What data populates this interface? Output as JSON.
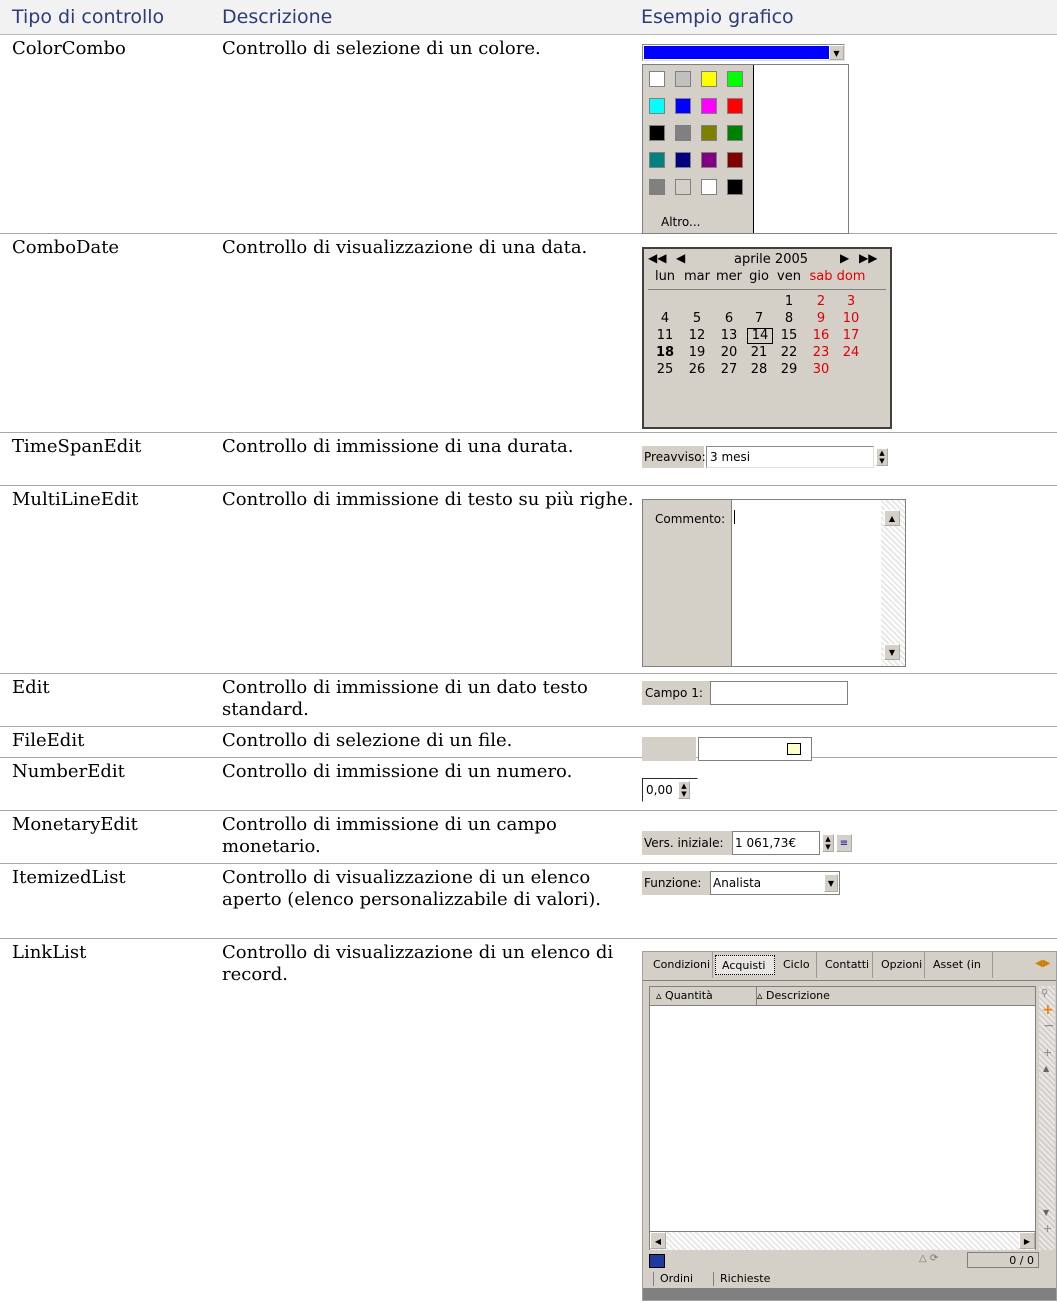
{
  "header": {
    "col_type": "Tipo di controllo",
    "col_desc": "Descrizione",
    "col_example": "Esempio grafico"
  },
  "rows": [
    {
      "type": "ColorCombo",
      "desc": "Controllo di selezione di un colore."
    },
    {
      "type": "ComboDate",
      "desc": "Controllo di visualizzazione di una data."
    },
    {
      "type": "TimeSpanEdit",
      "desc": "Controllo di immissione di una durata."
    },
    {
      "type": "MultiLineEdit",
      "desc": "Controllo di immissione di testo su più righe."
    },
    {
      "type": "Edit",
      "desc": "Controllo di immissione di un dato testo standard."
    },
    {
      "type": "FileEdit",
      "desc": "Controllo di selezione di un file."
    },
    {
      "type": "NumberEdit",
      "desc": "Controllo di immissione di un numero."
    },
    {
      "type": "MonetaryEdit",
      "desc": "Controllo di immissione di un campo monetario."
    },
    {
      "type": "ItemizedList",
      "desc": "Controllo di visualizzazione di un elenco aperto (elenco personalizzabile di valori)."
    },
    {
      "type": "LinkList",
      "desc": "Controllo di visualizzazione di un elenco di record."
    }
  ],
  "colorcombo": {
    "selected_color": "#0000ff",
    "swatches": [
      "#ffffff",
      "#c0c0c0",
      "#ffff00",
      "#00ff00",
      "#00ffff",
      "#0000ff",
      "#ff00ff",
      "#ff0000",
      "#000000",
      "#808080",
      "#808000",
      "#008000",
      "#008080",
      "#000080",
      "#800080",
      "#800000",
      "#808080",
      "#d4d0c8",
      "#ffffff",
      "#000000"
    ],
    "other_label": "Altro..."
  },
  "calendar": {
    "month": "aprile 2005",
    "days": [
      "lun",
      "mar",
      "mer",
      "gio",
      "ven",
      "sab",
      "dom"
    ],
    "weeks": [
      [
        "",
        "",
        "",
        "",
        "1",
        "2",
        "3"
      ],
      [
        "4",
        "5",
        "6",
        "7",
        "8",
        "9",
        "10"
      ],
      [
        "11",
        "12",
        "13",
        "14",
        "15",
        "16",
        "17"
      ],
      [
        "18",
        "19",
        "20",
        "21",
        "22",
        "23",
        "24"
      ],
      [
        "25",
        "26",
        "27",
        "28",
        "29",
        "30",
        ""
      ]
    ],
    "selected": "14",
    "today": "18"
  },
  "timespan": {
    "label": "Preavviso:",
    "value": "3 mesi"
  },
  "multiline": {
    "label": "Commento:"
  },
  "edit": {
    "label": "Campo 1:"
  },
  "number": {
    "value": "0,00"
  },
  "monetary": {
    "label": "Vers. iniziale:",
    "value": "1 061,73€"
  },
  "itemized": {
    "label": "Funzione:",
    "value": "Analista"
  },
  "linklist": {
    "tabs": [
      "Condizioni",
      "Acquisti",
      "Ciclo",
      "Contatti",
      "Opzioni",
      "Asset (in le"
    ],
    "active_tab": "Acquisti",
    "columns": [
      "Quantità",
      "Descrizione"
    ],
    "counter": "0 / 0",
    "bottom_tabs": [
      "Ordini",
      "Richieste"
    ]
  }
}
